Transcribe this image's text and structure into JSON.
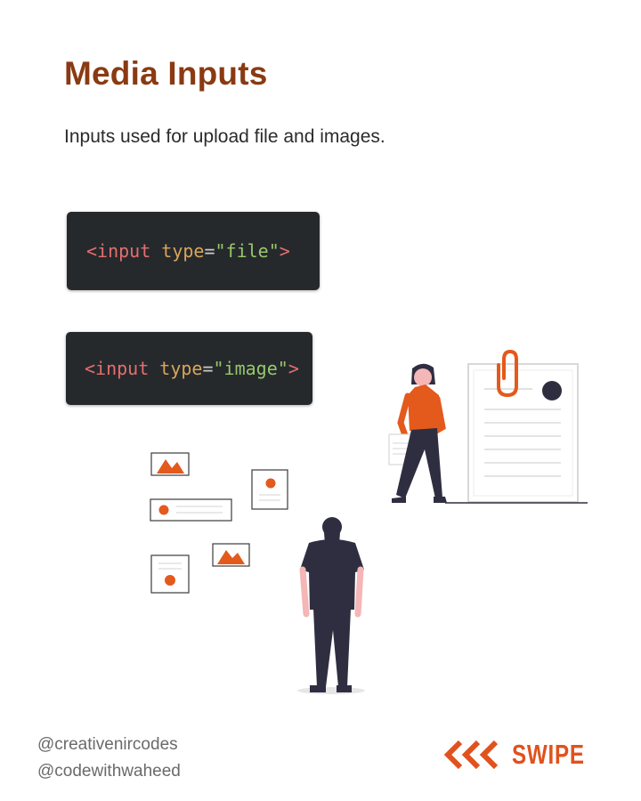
{
  "page": {
    "title": "Media Inputs",
    "subtitle": "Inputs used for upload file and images."
  },
  "code_blocks": [
    {
      "tag_open": "<input",
      "space": " ",
      "attr": "type",
      "eq": "=",
      "value": "\"file\"",
      "tag_close": ">"
    },
    {
      "tag_open": "<input",
      "space": " ",
      "attr": "type",
      "eq": "=",
      "value": "\"image\"",
      "tag_close": ">"
    }
  ],
  "footer": {
    "handle_1": "@creativenircodes",
    "handle_2": "@codewithwaheed",
    "swipe_label": "SWIPE",
    "swipe_icon": "triple-chevron-left-icon"
  },
  "colors": {
    "title": "#8a3a12",
    "accent": "#e0521e",
    "code_bg": "#26292c",
    "illustration_orange": "#e35a1c",
    "illustration_dark": "#2f2e41"
  }
}
